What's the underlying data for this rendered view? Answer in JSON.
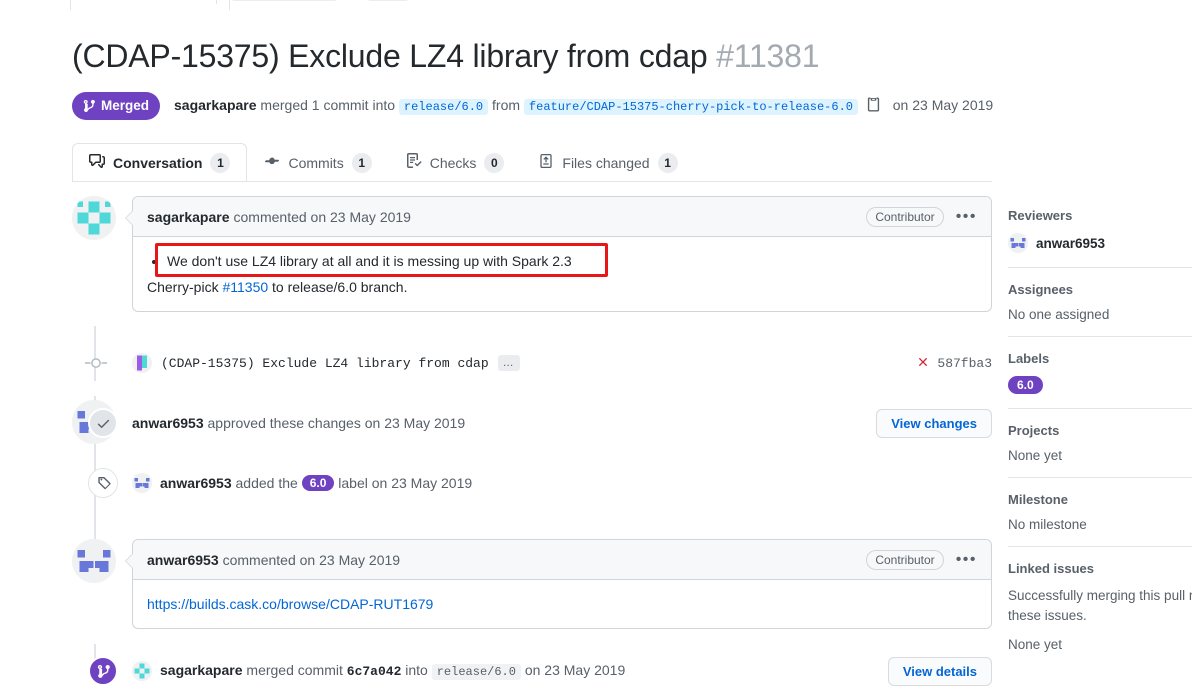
{
  "header": {
    "title": "(CDAP-15375) Exclude LZ4 library from cdap",
    "number": "#11381",
    "state": "Merged",
    "state_icon": "git-merge-icon",
    "state_color": "#6f42c1",
    "merger": "sagarkapare",
    "merged_text_1": "merged 1 commit into",
    "base_branch": "release/6.0",
    "from_word": "from",
    "head_branch": "feature/CDAP-15375-cherry-pick-to-release-6.0",
    "copy_icon": "clipboard-copy-icon",
    "merged_date": "on 23 May 2019"
  },
  "tabs": [
    {
      "label": "Conversation",
      "count": "1",
      "icon": "comment-discussion-icon",
      "active": true
    },
    {
      "label": "Commits",
      "count": "1",
      "icon": "git-commit-icon",
      "active": false
    },
    {
      "label": "Checks",
      "count": "0",
      "icon": "checklist-icon",
      "active": false
    },
    {
      "label": "Files changed",
      "count": "1",
      "icon": "file-diff-icon",
      "active": false
    }
  ],
  "timeline": {
    "comment1": {
      "author": "sagarkapare",
      "action": "commented on",
      "date": "23 May 2019",
      "association": "Contributor",
      "menu": "•••",
      "bullet": "We don't use LZ4 library at all and it is messing up with Spark 2.3",
      "body_prefix": "Cherry-pick ",
      "body_link": "#11350",
      "body_suffix": " to release/6.0 branch."
    },
    "commit": {
      "message": "(CDAP-15375) Exclude LZ4 library from cdap",
      "expand": "…",
      "status_icon": "x-cross-icon",
      "status_color": "#cb2431",
      "sha": "587fba3"
    },
    "approval": {
      "icon": "check-icon",
      "author": "anwar6953",
      "text": "approved these changes on 23 May 2019",
      "button": "View changes"
    },
    "labeled": {
      "icon": "tag-icon",
      "author": "anwar6953",
      "action": "added the",
      "label": "6.0",
      "suffix": "label on 23 May 2019"
    },
    "comment2": {
      "author": "anwar6953",
      "action": "commented on",
      "date": "23 May 2019",
      "association": "Contributor",
      "menu": "•••",
      "body_link": "https://builds.cask.co/browse/CDAP-RUT1679"
    },
    "merged": {
      "icon": "git-merge-icon",
      "author": "sagarkapare",
      "action": "merged commit",
      "sha": "6c7a042",
      "into": "into",
      "branch": "release/6.0",
      "date": "on 23 May 2019",
      "button": "View details"
    }
  },
  "sidebar": {
    "reviewers": {
      "title": "Reviewers",
      "user": "anwar6953"
    },
    "assignees": {
      "title": "Assignees",
      "value": "No one assigned"
    },
    "labels": {
      "title": "Labels",
      "chips": [
        "6.0"
      ]
    },
    "projects": {
      "title": "Projects",
      "value": "None yet"
    },
    "milestone": {
      "title": "Milestone",
      "value": "No milestone"
    },
    "linked_issues": {
      "title": "Linked issues",
      "note_line1": "Successfully merging this pull requ",
      "note_line2": "these issues.",
      "value": "None yet"
    }
  }
}
